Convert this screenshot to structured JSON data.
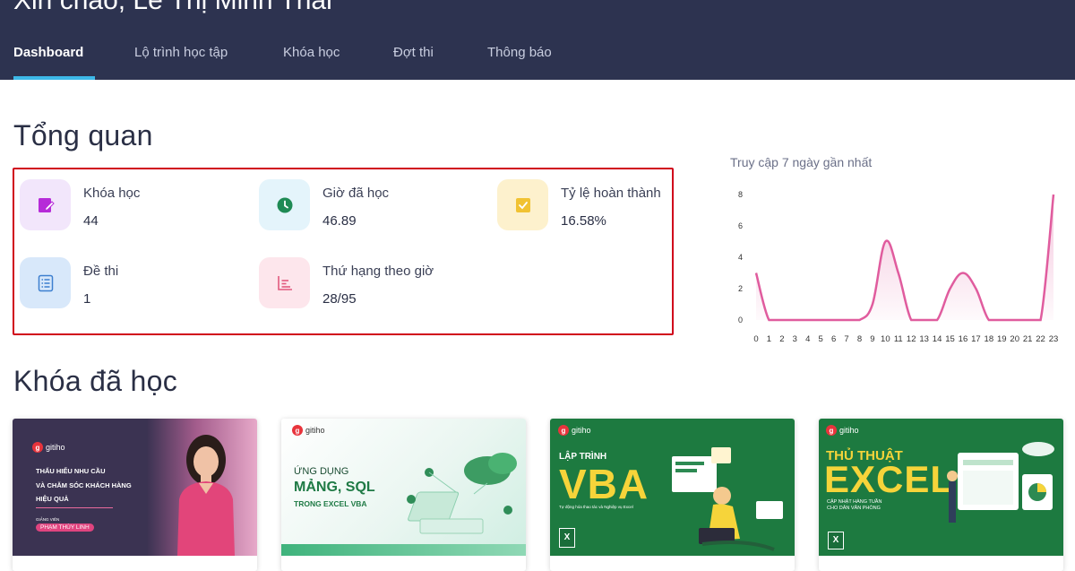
{
  "header": {
    "greeting": "Xin chào, Lê Thị Minh Thái",
    "tabs": [
      {
        "label": "Dashboard",
        "active": true
      },
      {
        "label": "Lộ trình học tập"
      },
      {
        "label": "Khóa học"
      },
      {
        "label": "Đợt thi"
      },
      {
        "label": "Thông báo"
      }
    ]
  },
  "overview": {
    "title": "Tổng quan",
    "stats": [
      {
        "label": "Khóa học",
        "value": "44",
        "icon": "edit-document-icon",
        "color": "#b62bd8",
        "bg": "#f2e6fb"
      },
      {
        "label": "Giờ đã học",
        "value": "46.89",
        "icon": "clock-icon",
        "color": "#1e8a54",
        "bg": "#e4f4fb"
      },
      {
        "label": "Tỷ lệ hoàn thành",
        "value": "16.58%",
        "icon": "checkbox-icon",
        "color": "#f1c232",
        "bg": "#fdf1cd"
      },
      {
        "label": "Đề thi",
        "value": "1",
        "icon": "checklist-icon",
        "color": "#3d7fcf",
        "bg": "#d8e8fa"
      },
      {
        "label": "Thứ hạng theo giờ",
        "value": "28/95",
        "icon": "bar-chart-icon",
        "color": "#e25a7e",
        "bg": "#fde6ec"
      }
    ]
  },
  "chart_data": {
    "type": "area",
    "title": "Truy cập 7 ngày gần nhất",
    "x": [
      "0",
      "1",
      "2",
      "3",
      "4",
      "5",
      "6",
      "7",
      "8",
      "9",
      "10",
      "11",
      "12",
      "13",
      "14",
      "15",
      "16",
      "17",
      "18",
      "19",
      "20",
      "21",
      "22",
      "23"
    ],
    "values": [
      3,
      0,
      0,
      0,
      0,
      0,
      0,
      0,
      0,
      1,
      5,
      3,
      0,
      0,
      0,
      2,
      3,
      2,
      0,
      0,
      0,
      0,
      0,
      8
    ],
    "yticks": [
      "0",
      "2",
      "4",
      "6",
      "8"
    ],
    "ylim": [
      0,
      8
    ],
    "color": "#e05c9e"
  },
  "courses": {
    "title": "Khóa đã học",
    "items": [
      {
        "brand": "gitiho",
        "lines": [
          "THẤU HIỂU NHU CẦU",
          "VÀ CHĂM SÓC KHÁCH HÀNG",
          "HIỆU QUẢ"
        ],
        "teacher_label": "GIẢNG VIÊN",
        "teacher": "PHẠM THÙY LINH"
      },
      {
        "brand": "gitiho",
        "lines": [
          "ỨNG DỤNG",
          "MẢNG, SQL",
          "TRONG EXCEL VBA"
        ]
      },
      {
        "brand": "gitiho",
        "lines": [
          "LẬP TRÌNH",
          "VBA",
          "Tự động hóa thao tác và Nghiệp vụ Excel"
        ]
      },
      {
        "brand": "gitiho",
        "lines": [
          "THỦ THUẬT",
          "EXCEL",
          "CẬP NHẬT HÀNG TUẦN",
          "CHO DÂN VĂN PHÒNG"
        ]
      }
    ]
  }
}
